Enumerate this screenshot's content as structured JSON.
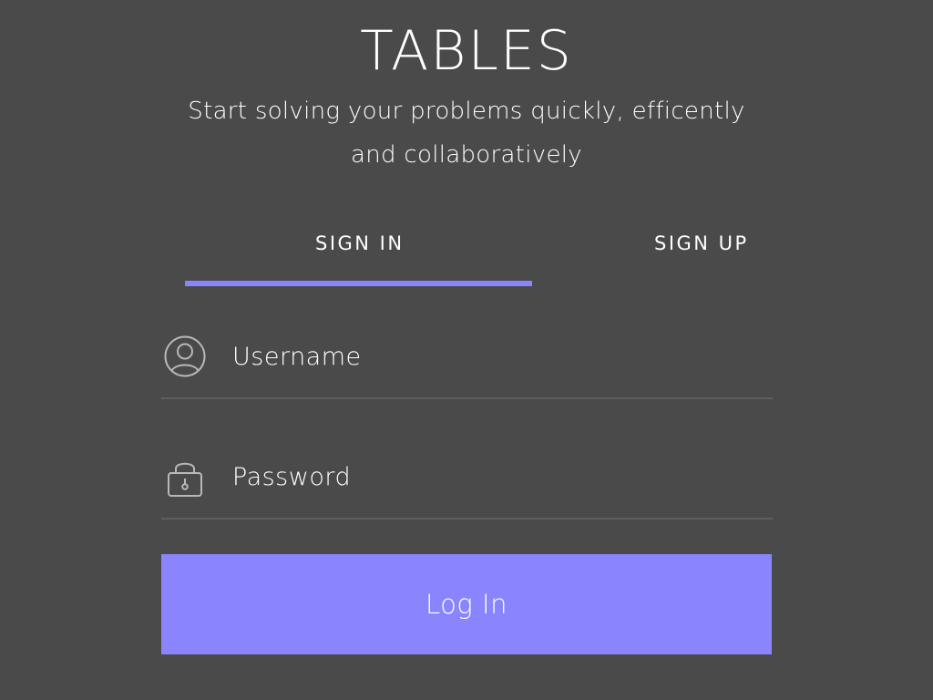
{
  "header": {
    "title": "TABLES",
    "tagline": "Start solving your problems quickly, efficently and collaboratively"
  },
  "tabs": [
    {
      "label": "SIGN IN",
      "active": true
    },
    {
      "label": "SIGN UP",
      "active": false
    }
  ],
  "form": {
    "username": {
      "placeholder": "Username",
      "value": "",
      "icon": "user-circle-icon"
    },
    "password": {
      "placeholder": "Password",
      "value": "",
      "icon": "lock-icon"
    },
    "submit_label": "Log In"
  },
  "colors": {
    "background": "#4a4a4a",
    "accent": "#8a84ff",
    "text": "#ffffff",
    "divider": "#5e5e5e"
  }
}
